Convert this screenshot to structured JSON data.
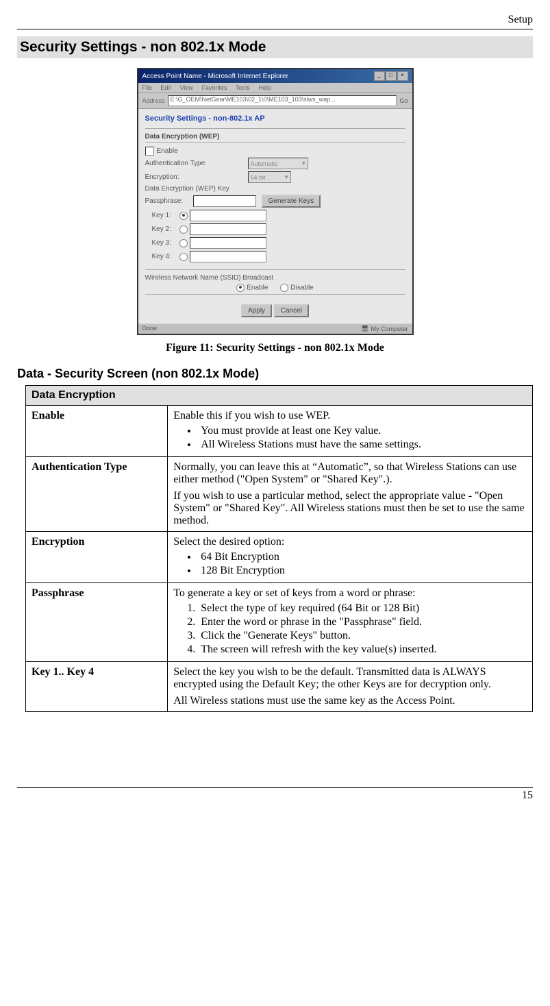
{
  "header": {
    "chapter": "Setup"
  },
  "section_title": "Security Settings - non 802.1x Mode",
  "screenshot": {
    "window_title": "Access Point Name - Microsoft Internet Explorer",
    "menus": {
      "file": "File",
      "edit": "Edit",
      "view": "View",
      "favorites": "Favorites",
      "tools": "Tools",
      "help": "Help"
    },
    "address_label": "Address",
    "address_value": "E:\\G_OEM\\NetGear\\ME103\\02_1\\0\\ME103_103\\slws_wap...",
    "go_label": "Go",
    "page_heading": "Security Settings - non-802.1x AP",
    "group_title": "Data Encryption (WEP)",
    "enable_label": "Enable",
    "auth_label": "Authentication Type:",
    "auth_value": "Automatic",
    "enc_label": "Encryption:",
    "enc_value": "64 bit",
    "wepkey_label": "Data Encryption (WEP) Key",
    "pass_label": "Passphrase:",
    "gen_label": "Generate Keys",
    "key1": "Key 1:",
    "key2": "Key 2:",
    "key3": "Key 3:",
    "key4": "Key 4:",
    "ssid_label": "Wireless Network Name (SSID) Broadcast",
    "radio_enable": "Enable",
    "radio_disable": "Disable",
    "apply": "Apply",
    "cancel": "Cancel",
    "status_left": "Done",
    "status_right": "My Computer"
  },
  "figcaption": "Figure 11: Security Settings - non 802.1x Mode",
  "subsection_title": "Data - Security Screen (non 802.1x Mode)",
  "table": {
    "category": "Data Encryption",
    "rows": {
      "enable": {
        "label": "Enable",
        "intro": "Enable this if you wish to use WEP.",
        "b1": "You must provide at least one Key value.",
        "b2": "All Wireless Stations must have the same settings."
      },
      "auth": {
        "label": "Authentication Type",
        "p1": "Normally, you can leave this at “Automatic”, so that Wireless Stations can use either method (\"Open System\" or \"Shared Key\".).",
        "p2": "If you wish to use a particular method, select the appropriate value - \"Open System\" or \"Shared Key\". All Wireless stations must then be set to use the same method."
      },
      "enc": {
        "label": "Encryption",
        "intro": "Select the desired option:",
        "b1": "64 Bit Encryption",
        "b2": "128 Bit Encryption"
      },
      "pass": {
        "label": "Passphrase",
        "intro": "To generate a key or set of keys from a word or phrase:",
        "s1": "Select the type of key required (64 Bit or 128 Bit)",
        "s2": "Enter the word or phrase in the \"Passphrase\" field.",
        "s3": "Click the \"Generate Keys\" button.",
        "s4": "The screen will refresh with the key value(s) inserted."
      },
      "keys": {
        "label": "Key 1.. Key 4",
        "p1": "Select the key you wish to be the default. Transmitted data is ALWAYS encrypted using the Default Key; the other Keys are for decryption only.",
        "p2": "All Wireless stations must use the same key as the Access Point."
      }
    }
  },
  "page_number": "15"
}
